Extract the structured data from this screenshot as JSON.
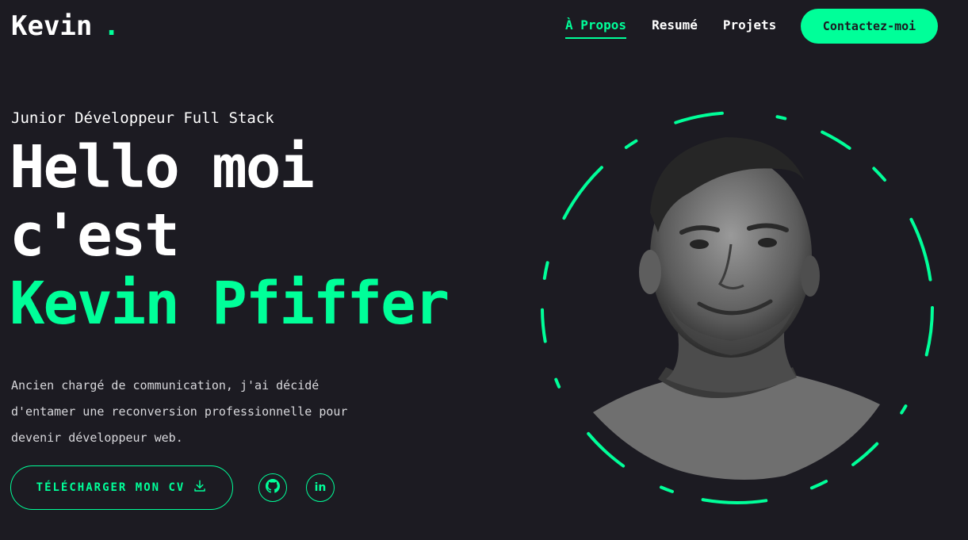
{
  "header": {
    "logo_text": "Kevin",
    "logo_dot": ".",
    "nav": [
      {
        "label": "À Propos",
        "active": true
      },
      {
        "label": "Resumé",
        "active": false
      },
      {
        "label": "Projets",
        "active": false
      }
    ],
    "contact_label": "Contactez-moi"
  },
  "hero": {
    "subtitle": "Junior Développeur Full Stack",
    "headline_line1": "Hello moi",
    "headline_line2": "c'est",
    "headline_name": "Kevin Pfiffer",
    "description": "Ancien chargé de communication, j'ai décidé d'entamer une reconversion professionnelle pour devenir développeur web.",
    "cv_button_label": "TÉLÉCHARGER MON CV",
    "cv_icon": "download-icon",
    "socials": [
      {
        "name": "github-icon"
      },
      {
        "name": "linkedin-icon",
        "text": "in"
      }
    ]
  },
  "colors": {
    "background": "#1c1b22",
    "accent": "#00ff99",
    "text": "#ffffff"
  }
}
